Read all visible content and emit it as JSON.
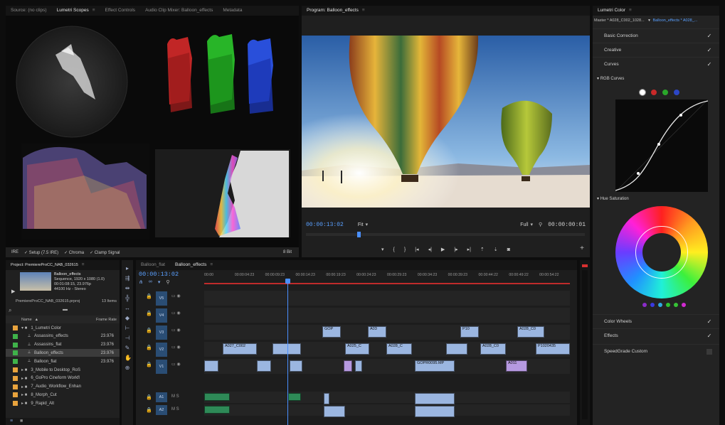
{
  "source_tabs": [
    "Source: (no clips)",
    "Lumetri Scopes",
    "Effect Controls",
    "Audio Clip Mixer: Balloon_effects",
    "Metadata"
  ],
  "scopes_footer": {
    "preset": "IRE",
    "setup": "✓ Setup (7.5 IRE)",
    "chroma": "✓ Chroma",
    "clamp": "✓ Clamp Signal",
    "bits": "8 Bit"
  },
  "program": {
    "tab": "Program: Balloon_effects",
    "timecode": "00:00:13:02",
    "fit": "Fit",
    "quality": "Full",
    "duration": "00:00:00:01"
  },
  "lumetri": {
    "tab": "Lumetri Color",
    "master": "Master * A028_C002_1028...",
    "clip": "Balloon_effects * A028_...",
    "sections": [
      "Basic Correction",
      "Creative",
      "Curves"
    ],
    "rgb_curves": "RGB Curves",
    "hue_saturation": "Hue Saturation",
    "bottom_sections": [
      "Color Wheels",
      "Effects",
      "SpeedGrade Custom"
    ]
  },
  "project": {
    "tab": "Project: PremiereProCC_NAB_032615",
    "clip_name": "Balloon_effects",
    "clip_info": [
      "Sequence, 1920 x 1080 (1.0)",
      "00:01:08:15, 23.976p",
      "44100 Hz - Stereo"
    ],
    "file": "PremiereProCC_NAB_032615.prproj",
    "items_count": "13 Items",
    "col_name": "Name",
    "col_rate": "Frame Rate",
    "rows": [
      {
        "name": "1_Lumetri Color",
        "rate": "",
        "color": "#e8a33d",
        "indent": 0,
        "folder": true
      },
      {
        "name": "Assassins_effects",
        "rate": "23.976",
        "color": "#3fb24a",
        "indent": 1,
        "folder": false
      },
      {
        "name": "Assassins_flat",
        "rate": "23.976",
        "color": "#3fb24a",
        "indent": 1,
        "folder": false
      },
      {
        "name": "Balloon_effects",
        "rate": "23.976",
        "color": "#3fb24a",
        "indent": 1,
        "folder": false
      },
      {
        "name": "Balloon_flat",
        "rate": "23.976",
        "color": "#3fb24a",
        "indent": 1,
        "folder": false
      },
      {
        "name": "3_Mobile to Desktop_RoS",
        "rate": "",
        "color": "#e8a33d",
        "indent": 0,
        "folder": true
      },
      {
        "name": "6_GoPro Cineform Workfl",
        "rate": "",
        "color": "#e8a33d",
        "indent": 0,
        "folder": true
      },
      {
        "name": "7_Audio_Workflow_Enhan",
        "rate": "",
        "color": "#e8a33d",
        "indent": 0,
        "folder": true
      },
      {
        "name": "8_Morph_Cut",
        "rate": "",
        "color": "#e8a33d",
        "indent": 0,
        "folder": true
      },
      {
        "name": "9_Rapid_Alt",
        "rate": "",
        "color": "#e8a33d",
        "indent": 0,
        "folder": true
      }
    ]
  },
  "timeline": {
    "tabs": [
      "Balloon_flat",
      "Balloon_effects"
    ],
    "timecode": "00:00:13:02",
    "ruler": [
      "00:00",
      "00:00:04:23",
      "00:00:09:23",
      "00:00:14:23",
      "00:00:19:23",
      "00:00:24:23",
      "00:00:29:23",
      "00:00:34:23",
      "00:00:39:23",
      "00:00:44:22",
      "00:00:49:22",
      "00:00:54:22"
    ],
    "tracks": [
      "V5",
      "V4",
      "V3",
      "V2",
      "V1",
      "A1",
      "A2"
    ],
    "clips": [
      "GOP",
      "A03",
      "P10",
      "A028_C0",
      "A027_C002",
      "A025_C",
      "A028_C",
      "A028_C0",
      "P1020435",
      "GOPR0095.MP",
      "A011"
    ]
  }
}
